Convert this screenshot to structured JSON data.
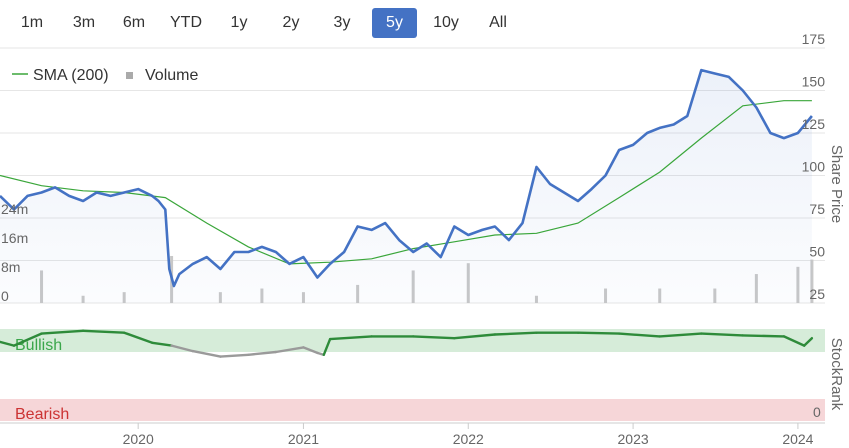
{
  "range_selector": {
    "buttons": [
      "1m",
      "3m",
      "6m",
      "YTD",
      "1y",
      "2y",
      "3y",
      "5y",
      "10y",
      "All"
    ],
    "selected": "5y"
  },
  "colors": {
    "price": "#4472c4",
    "sma": "#3aa63a",
    "volume": "#c8c8c8",
    "stockrank_bullish": "#2e8b3a",
    "stockrank_neutral": "#9a9a9a",
    "bullish_band": "#d6ecd9",
    "bearish_band": "#f6d6d8",
    "bullish_text": "#3aa64a",
    "bearish_text": "#cc3333",
    "selected_button": "#4472c4",
    "grid": "#e6e6e6"
  },
  "chart_data": [
    {
      "type": "line",
      "legend": {
        "position": "top-left",
        "items": [
          "SMA (200)",
          "Volume"
        ]
      },
      "right_axis": {
        "label": "Share Price",
        "ticks": [
          "25",
          "50",
          "75",
          "100",
          "125",
          "150",
          "175"
        ],
        "ylim": [
          25,
          175
        ]
      },
      "left_axis": {
        "ticks": [
          "0",
          "8m",
          "16m",
          "24m"
        ],
        "ylim": [
          0,
          34
        ]
      },
      "x_axis": {
        "ticks": [
          "2020",
          "2021",
          "2022",
          "2023",
          "2024"
        ],
        "range": [
          "2019-03-01",
          "2024-03-01"
        ]
      },
      "series": [
        {
          "name": "Share Price",
          "x": [
            "2019-03-01",
            "2019-04-01",
            "2019-05-01",
            "2019-06-01",
            "2019-07-01",
            "2019-08-01",
            "2019-09-01",
            "2019-10-01",
            "2019-11-01",
            "2019-12-01",
            "2020-01-01",
            "2020-02-01",
            "2020-02-15",
            "2020-03-01",
            "2020-03-10",
            "2020-03-20",
            "2020-04-01",
            "2020-05-01",
            "2020-06-01",
            "2020-07-01",
            "2020-08-01",
            "2020-09-01",
            "2020-10-01",
            "2020-11-01",
            "2020-12-01",
            "2021-01-01",
            "2021-02-01",
            "2021-03-01",
            "2021-04-01",
            "2021-05-01",
            "2021-06-01",
            "2021-07-01",
            "2021-08-01",
            "2021-09-01",
            "2021-10-01",
            "2021-11-01",
            "2021-12-01",
            "2022-01-01",
            "2022-02-01",
            "2022-03-01",
            "2022-04-01",
            "2022-05-01",
            "2022-06-01",
            "2022-07-01",
            "2022-08-01",
            "2022-09-01",
            "2022-10-01",
            "2022-11-01",
            "2022-12-01",
            "2023-01-01",
            "2023-02-01",
            "2023-03-01",
            "2023-04-01",
            "2023-05-01",
            "2023-06-01",
            "2023-07-01",
            "2023-08-01",
            "2023-09-01",
            "2023-10-01",
            "2023-11-01",
            "2023-12-01",
            "2024-01-01",
            "2024-02-01"
          ],
          "values": [
            88,
            80,
            88,
            90,
            93,
            88,
            85,
            90,
            88,
            90,
            92,
            88,
            85,
            80,
            45,
            35,
            42,
            48,
            52,
            45,
            55,
            55,
            58,
            55,
            48,
            52,
            40,
            48,
            55,
            70,
            68,
            72,
            62,
            55,
            60,
            52,
            70,
            65,
            68,
            70,
            62,
            72,
            105,
            95,
            90,
            85,
            92,
            100,
            115,
            118,
            125,
            128,
            130,
            135,
            162,
            160,
            158,
            150,
            140,
            125,
            122,
            125,
            135
          ]
        },
        {
          "name": "SMA (200)",
          "x": [
            "2019-03-01",
            "2019-06-01",
            "2019-09-01",
            "2019-12-01",
            "2020-03-01",
            "2020-06-01",
            "2020-09-01",
            "2020-12-01",
            "2021-03-01",
            "2021-06-01",
            "2021-09-01",
            "2021-12-01",
            "2022-03-01",
            "2022-06-01",
            "2022-09-01",
            "2022-12-01",
            "2023-03-01",
            "2023-06-01",
            "2023-09-01",
            "2023-12-01",
            "2024-02-01"
          ],
          "values": [
            100,
            94,
            91,
            90,
            87,
            72,
            58,
            48,
            49,
            51,
            57,
            61,
            65,
            66,
            72,
            87,
            102,
            122,
            141,
            144,
            144
          ]
        },
        {
          "name": "Volume",
          "x": [
            "2019-06-01",
            "2019-09-01",
            "2019-12-01",
            "2020-03-15",
            "2020-07-01",
            "2020-10-01",
            "2021-01-01",
            "2021-05-01",
            "2021-09-01",
            "2022-01-01",
            "2022-06-01",
            "2022-11-01",
            "2023-03-01",
            "2023-07-01",
            "2023-10-01",
            "2024-01-01",
            "2024-02-01"
          ],
          "values": [
            9,
            2,
            3,
            13,
            3,
            4,
            3,
            5,
            9,
            11,
            2,
            4,
            4,
            4,
            8,
            10,
            12
          ]
        }
      ]
    },
    {
      "type": "line",
      "title": "StockRank",
      "bands": [
        "Bullish",
        "Bearish"
      ],
      "y_ticks": [
        "0"
      ],
      "ylim": [
        0,
        100
      ],
      "series": [
        {
          "name": "StockRank",
          "x": [
            "2019-03-01",
            "2019-04-01",
            "2019-06-01",
            "2019-09-01",
            "2019-12-01",
            "2020-02-01",
            "2020-03-15",
            "2020-05-01",
            "2020-07-01",
            "2020-09-01",
            "2020-11-01",
            "2021-01-01",
            "2021-02-01",
            "2021-02-15",
            "2021-03-01",
            "2021-06-01",
            "2021-09-01",
            "2021-12-01",
            "2022-03-01",
            "2022-06-01",
            "2022-09-01",
            "2022-12-01",
            "2023-03-01",
            "2023-06-01",
            "2023-09-01",
            "2023-12-01",
            "2024-01-15",
            "2024-02-01"
          ],
          "values": [
            86,
            82,
            95,
            98,
            96,
            85,
            82,
            76,
            70,
            72,
            75,
            80,
            74,
            72,
            89,
            92,
            92,
            90,
            94,
            96,
            96,
            95,
            92,
            95,
            93,
            92,
            82,
            90
          ],
          "segment_status": [
            "bullish",
            "bullish",
            "bullish",
            "bullish",
            "bullish",
            "bullish",
            "neutral",
            "neutral",
            "neutral",
            "neutral",
            "neutral",
            "neutral",
            "neutral",
            "bullish",
            "bullish",
            "bullish",
            "bullish",
            "bullish",
            "bullish",
            "bullish",
            "bullish",
            "bullish",
            "bullish",
            "bullish",
            "bullish",
            "bullish",
            "bullish",
            "bullish"
          ]
        }
      ]
    }
  ]
}
